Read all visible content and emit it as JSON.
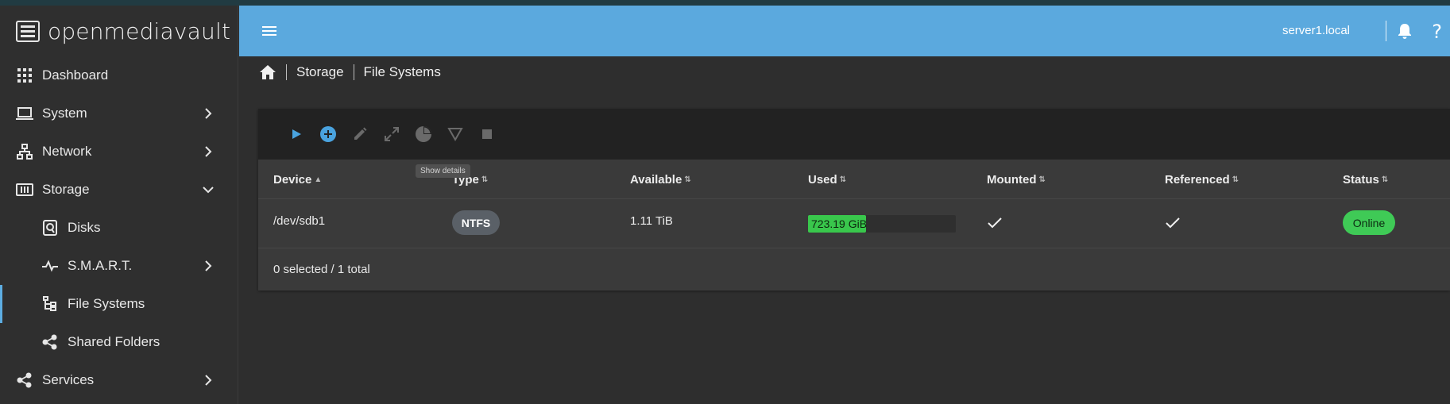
{
  "app": {
    "brand": "openmediavault"
  },
  "header": {
    "hostname": "server1.local"
  },
  "sidebar": {
    "items": [
      {
        "label": "Dashboard",
        "icon": "dashboard-grid-icon"
      },
      {
        "label": "System",
        "icon": "laptop-icon"
      },
      {
        "label": "Network",
        "icon": "network-icon"
      },
      {
        "label": "Storage",
        "icon": "storage-icon",
        "expanded": true
      },
      {
        "label": "Disks",
        "icon": "disk-icon"
      },
      {
        "label": "S.M.A.R.T.",
        "icon": "pulse-icon"
      },
      {
        "label": "File Systems",
        "icon": "file-tree-icon",
        "active": true
      },
      {
        "label": "Shared Folders",
        "icon": "share-icon"
      },
      {
        "label": "Services",
        "icon": "share-icon"
      }
    ]
  },
  "breadcrumb": {
    "items": [
      "Storage",
      "File Systems"
    ]
  },
  "toolbar": {
    "buttons": [
      "play-icon",
      "add-circle-icon",
      "edit-icon",
      "expand-icon",
      "pie-chart-icon",
      "filter-icon",
      "stop-icon"
    ],
    "tooltip": "Show details"
  },
  "table": {
    "columns": [
      "Device",
      "Type",
      "Available",
      "Used",
      "Mounted",
      "Referenced",
      "Status"
    ],
    "rows": [
      {
        "device": "/dev/sdb1",
        "type": "NTFS",
        "available": "1.11 TiB",
        "used": "723.19 GiB",
        "used_percent": 39,
        "mounted": true,
        "referenced": true,
        "status": "Online"
      }
    ],
    "footer": "0 selected / 1 total"
  },
  "colors": {
    "header": "#5ba9de",
    "accent": "#5dade2",
    "online": "#3fca56",
    "usage_bar": "#39c74c"
  }
}
